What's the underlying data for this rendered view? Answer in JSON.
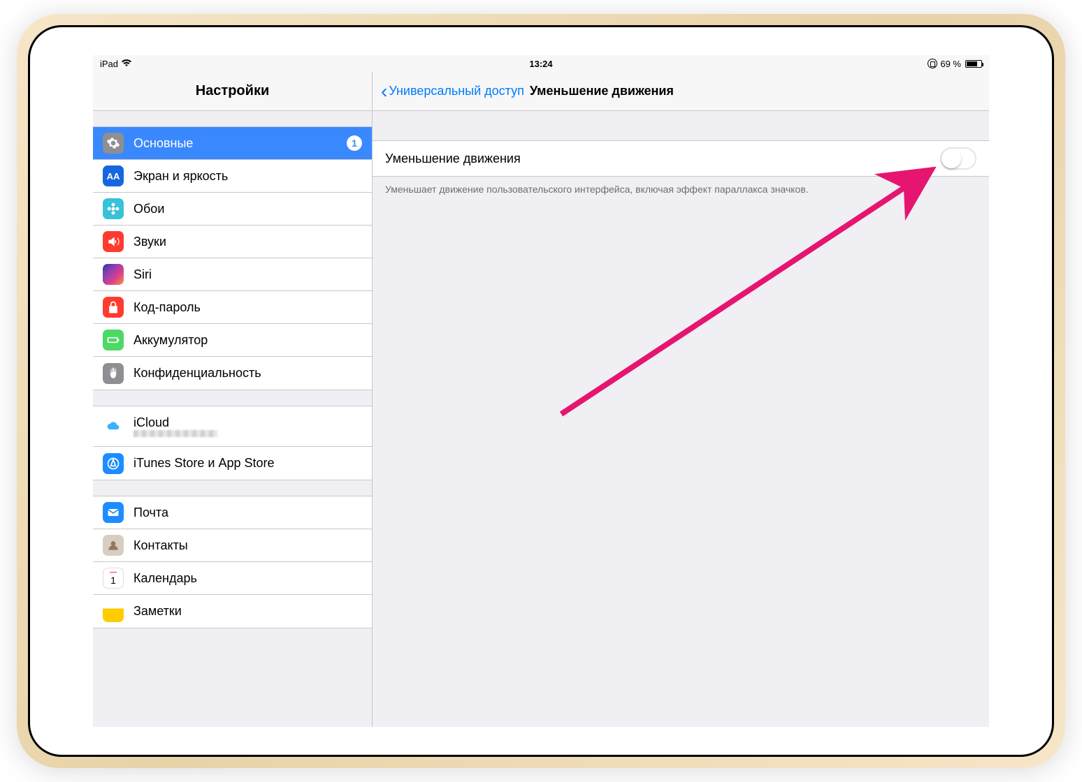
{
  "status": {
    "device": "iPad",
    "time": "13:24",
    "battery_text": "69 %"
  },
  "sidebar": {
    "title": "Настройки",
    "sections": [
      {
        "rows": [
          {
            "label": "Основные",
            "badge": "1"
          },
          {
            "label": "Экран и яркость"
          },
          {
            "label": "Обои"
          },
          {
            "label": "Звуки"
          },
          {
            "label": "Siri"
          },
          {
            "label": "Код-пароль"
          },
          {
            "label": "Аккумулятор"
          },
          {
            "label": "Конфиденциальность"
          }
        ]
      },
      {
        "rows": [
          {
            "label": "iCloud"
          },
          {
            "label": "iTunes Store и App Store"
          }
        ]
      },
      {
        "rows": [
          {
            "label": "Почта"
          },
          {
            "label": "Контакты"
          },
          {
            "label": "Календарь"
          },
          {
            "label": "Заметки"
          }
        ]
      }
    ]
  },
  "detail": {
    "back_label": "Универсальный доступ",
    "title": "Уменьшение движения",
    "row_label": "Уменьшение движения",
    "footer": "Уменьшает движение пользовательского интерфейса, включая эффект параллакса значков.",
    "toggle_on": false
  },
  "colors": {
    "accent": "#007aff",
    "selection": "#3a88fe",
    "arrow": "#e6156f"
  }
}
